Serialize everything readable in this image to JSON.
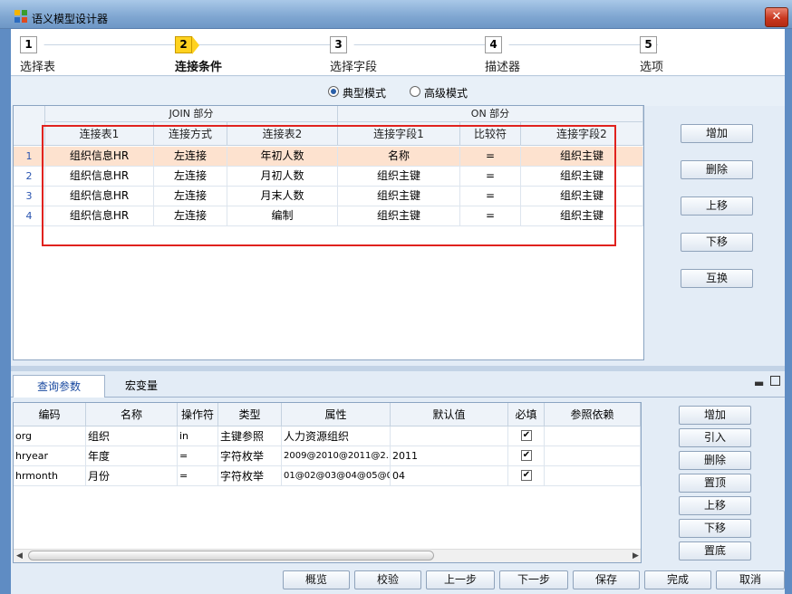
{
  "window": {
    "title": "语义模型设计器",
    "close_symbol": "✕"
  },
  "wizard": {
    "steps": [
      {
        "num": "1",
        "label": "选择表"
      },
      {
        "num": "2",
        "label": "连接条件"
      },
      {
        "num": "3",
        "label": "选择字段"
      },
      {
        "num": "4",
        "label": "描述器"
      },
      {
        "num": "5",
        "label": "选项"
      }
    ],
    "active_step": 2
  },
  "mode": {
    "options": [
      "典型模式",
      "高级模式"
    ],
    "selected": "典型模式"
  },
  "join_grid": {
    "group_headers": [
      "JOIN 部分",
      "ON 部分"
    ],
    "columns": [
      "连接表1",
      "连接方式",
      "连接表2",
      "连接字段1",
      "比较符",
      "连接字段2"
    ],
    "rows": [
      {
        "n": "1",
        "cells": [
          "组织信息HR",
          "左连接",
          "年初人数",
          "名称",
          "=",
          "组织主键"
        ]
      },
      {
        "n": "2",
        "cells": [
          "组织信息HR",
          "左连接",
          "月初人数",
          "组织主键",
          "=",
          "组织主键"
        ]
      },
      {
        "n": "3",
        "cells": [
          "组织信息HR",
          "左连接",
          "月末人数",
          "组织主键",
          "=",
          "组织主键"
        ]
      },
      {
        "n": "4",
        "cells": [
          "组织信息HR",
          "左连接",
          "编制",
          "组织主键",
          "=",
          "组织主键"
        ]
      }
    ],
    "selected_row": 1
  },
  "join_buttons": [
    "增加",
    "删除",
    "上移",
    "下移",
    "互换"
  ],
  "tabs": {
    "items": [
      "查询参数",
      "宏变量"
    ],
    "active": "查询参数"
  },
  "panel_icons": {
    "minimize": "▬",
    "maximize": "□"
  },
  "param_grid": {
    "columns": [
      "编码",
      "名称",
      "操作符",
      "类型",
      "属性",
      "默认值",
      "必填",
      "参照依赖"
    ],
    "rows": [
      {
        "cells": [
          "org",
          "组织",
          "in",
          "主键参照",
          "人力资源组织",
          "",
          "",
          ""
        ],
        "required": true
      },
      {
        "cells": [
          "hryear",
          "年度",
          "=",
          "字符枚举",
          "2009@2010@2011@2...",
          "2011",
          "",
          ""
        ],
        "required": true
      },
      {
        "cells": [
          "hrmonth",
          "月份",
          "=",
          "字符枚举",
          "01@02@03@04@05@0...",
          "04",
          "",
          ""
        ],
        "required": true
      }
    ],
    "check_mark": "✔",
    "scroll_left": "◀",
    "scroll_right": "▶"
  },
  "param_buttons": [
    "增加",
    "引入",
    "删除",
    "置顶",
    "上移",
    "下移",
    "置底"
  ],
  "footer_buttons": [
    "概览",
    "校验",
    "上一步",
    "下一步",
    "保存",
    "完成",
    "取消"
  ]
}
